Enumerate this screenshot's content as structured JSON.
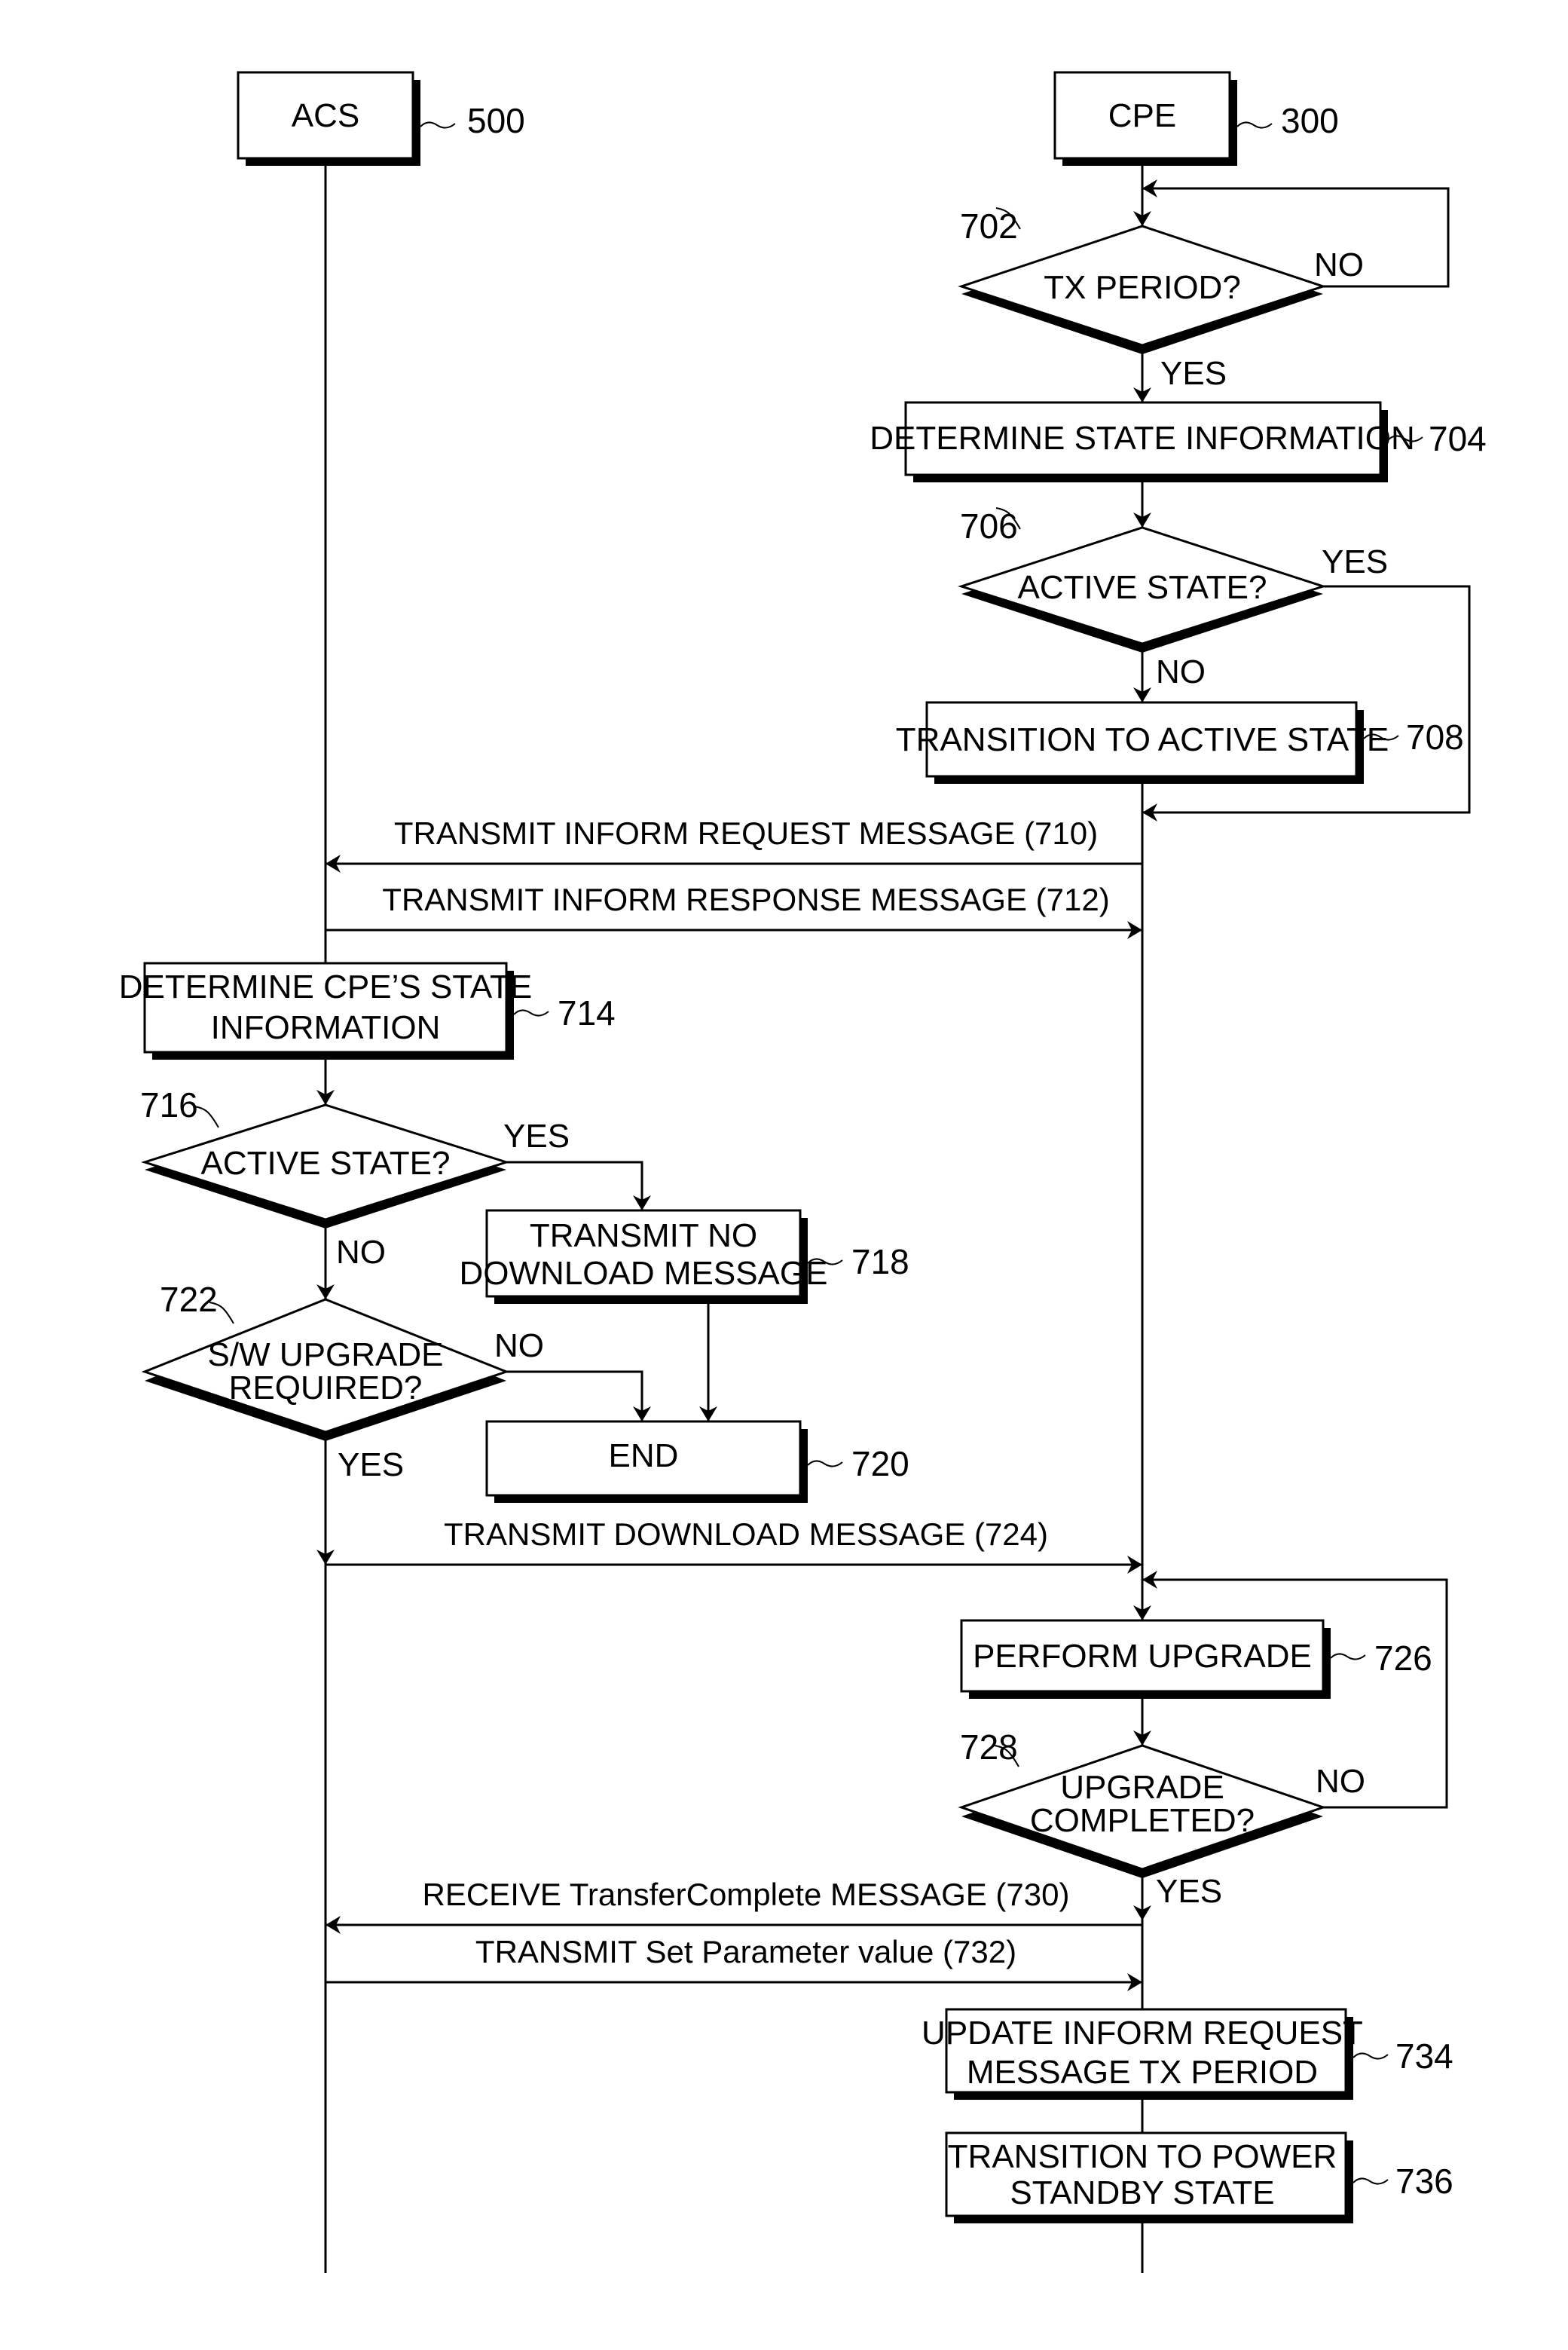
{
  "figure": {
    "entities": [
      {
        "id": "acs",
        "label": "ACS",
        "ref": "500"
      },
      {
        "id": "cpe",
        "label": "CPE",
        "ref": "300"
      }
    ],
    "steps": {
      "s702": {
        "ref": "702",
        "type": "decision",
        "lines": [
          "TX PERIOD?"
        ],
        "yes": "YES",
        "no": "NO"
      },
      "s704": {
        "ref": "704",
        "type": "process",
        "lines": [
          "DETERMINE STATE INFORMATION"
        ]
      },
      "s706": {
        "ref": "706",
        "type": "decision",
        "lines": [
          "ACTIVE STATE?"
        ],
        "yes": "YES",
        "no": "NO"
      },
      "s708": {
        "ref": "708",
        "type": "process",
        "lines": [
          "TRANSITION TO ACTIVE STATE"
        ]
      },
      "s714": {
        "ref": "714",
        "type": "process",
        "lines": [
          "DETERMINE CPE’S STATE",
          "INFORMATION"
        ]
      },
      "s716": {
        "ref": "716",
        "type": "decision",
        "lines": [
          "ACTIVE STATE?"
        ],
        "yes": "YES",
        "no": "NO"
      },
      "s718": {
        "ref": "718",
        "type": "process",
        "lines": [
          "TRANSMIT NO",
          "DOWNLOAD MESSAGE"
        ]
      },
      "s720": {
        "ref": "720",
        "type": "process",
        "lines": [
          "END"
        ]
      },
      "s722": {
        "ref": "722",
        "type": "decision",
        "lines": [
          "S/W UPGRADE",
          "REQUIRED?"
        ],
        "yes": "YES",
        "no": "NO"
      },
      "s726": {
        "ref": "726",
        "type": "process",
        "lines": [
          "PERFORM UPGRADE"
        ]
      },
      "s728": {
        "ref": "728",
        "type": "decision",
        "lines": [
          "UPGRADE",
          "COMPLETED?"
        ],
        "yes": "YES",
        "no": "NO"
      },
      "s734": {
        "ref": "734",
        "type": "process",
        "lines": [
          "UPDATE INFORM REQUEST",
          "MESSAGE TX PERIOD"
        ]
      },
      "s736": {
        "ref": "736",
        "type": "process",
        "lines": [
          "TRANSITION TO POWER",
          "STANDBY STATE"
        ]
      }
    },
    "messages": {
      "m710": {
        "text": "TRANSMIT INFORM REQUEST MESSAGE (710)",
        "from": "CPE",
        "to": "ACS"
      },
      "m712": {
        "text": "TRANSMIT INFORM RESPONSE MESSAGE (712)",
        "from": "ACS",
        "to": "CPE"
      },
      "m724": {
        "text": "TRANSMIT DOWNLOAD MESSAGE (724)",
        "from": "ACS",
        "to": "CPE"
      },
      "m730": {
        "text": "RECEIVE TransferComplete MESSAGE (730)",
        "from": "CPE",
        "to": "ACS"
      },
      "m732": {
        "text": "TRANSMIT Set Parameter value (732)",
        "from": "ACS",
        "to": "CPE"
      }
    }
  }
}
